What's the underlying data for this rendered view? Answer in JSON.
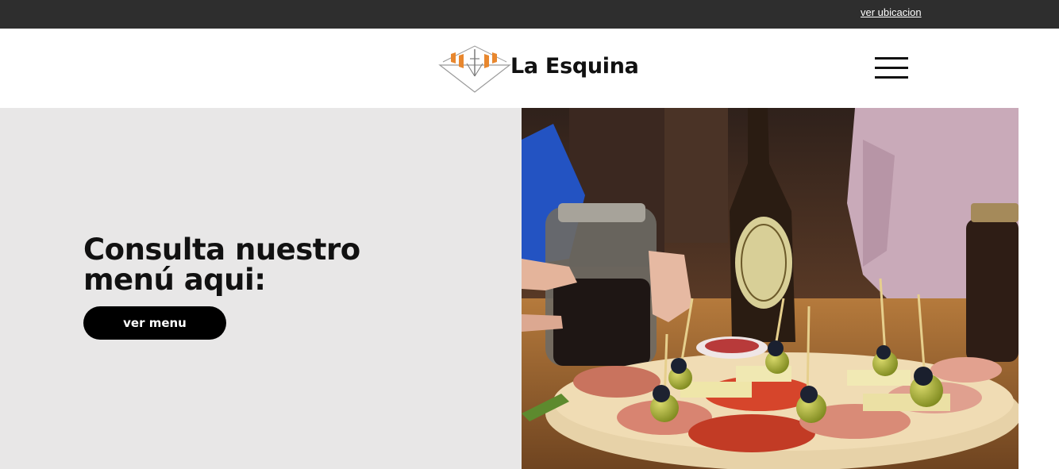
{
  "topbar": {
    "location_link": "ver ubicacion"
  },
  "header": {
    "brand_name": "La Esquina",
    "menu_icon": "hamburger-menu-icon",
    "logo_icon": "diamond-logo-icon"
  },
  "hero": {
    "heading": "Consulta nuestro menú aqui:",
    "button_label": "ver menu",
    "image": "food-photo"
  },
  "colors": {
    "topbar_bg": "#2e2e2e",
    "hero_bg": "#e8e7e7",
    "button_bg": "#000000",
    "logo_accent": "#e8872e"
  }
}
